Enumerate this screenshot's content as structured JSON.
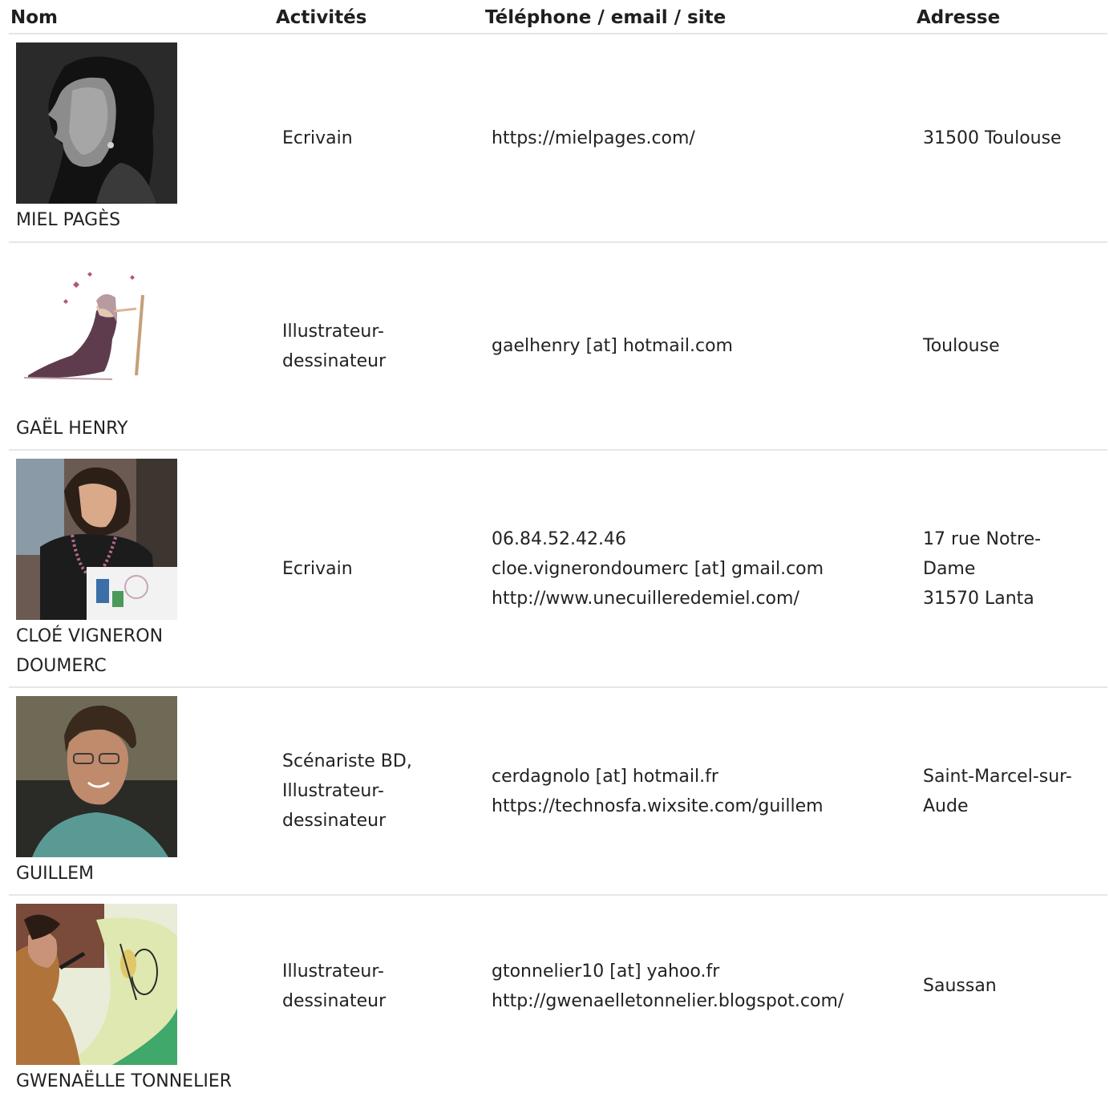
{
  "header": {
    "name": "Nom",
    "activities": "Activités",
    "contact": "Téléphone / email / site",
    "address": "Adresse"
  },
  "rows": [
    {
      "name_lines": [
        "MIEL PAGÈS"
      ],
      "activity_lines": [
        "Ecrivain"
      ],
      "contact_lines": [
        "https://mielpages.com/"
      ],
      "address_lines": [
        "31500 Toulouse"
      ],
      "photo_icon": "portrait-bw-profile"
    },
    {
      "name_lines": [
        "GAËL HENRY"
      ],
      "activity_lines": [
        "Illustrateur-",
        "dessinateur"
      ],
      "contact_lines": [
        "gaelhenry [at] hotmail.com"
      ],
      "address_lines": [
        "Toulouse"
      ],
      "photo_icon": "illustration-witch-with-staff"
    },
    {
      "name_lines": [
        "CLOÉ VIGNERON",
        "DOUMERC"
      ],
      "activity_lines": [
        "Ecrivain"
      ],
      "contact_lines": [
        "06.84.52.42.46",
        "cloe.vignerondoumerc [at] gmail.com",
        "http://www.unecuilleredemiel.com/"
      ],
      "address_lines": [
        "17 rue Notre-",
        "Dame",
        "31570 Lanta"
      ],
      "photo_icon": "photo-woman-with-book"
    },
    {
      "name_lines": [
        "GUILLEM"
      ],
      "activity_lines": [
        "Scénariste BD,",
        "Illustrateur-",
        "dessinateur"
      ],
      "contact_lines": [
        "cerdagnolo [at] hotmail.fr",
        "https://technosfa.wixsite.com/guillem"
      ],
      "address_lines": [
        "Saint-Marcel-sur-",
        "Aude"
      ],
      "photo_icon": "photo-smiling-man-glasses"
    },
    {
      "name_lines": [
        "GWENAËLLE TONNELIER"
      ],
      "activity_lines": [
        "Illustrateur-",
        "dessinateur"
      ],
      "contact_lines": [
        "gtonnelier10 [at] yahoo.fr",
        "http://gwenaelletonnelier.blogspot.com/"
      ],
      "address_lines": [
        "Saussan"
      ],
      "photo_icon": "photo-woman-painting-insect"
    }
  ]
}
